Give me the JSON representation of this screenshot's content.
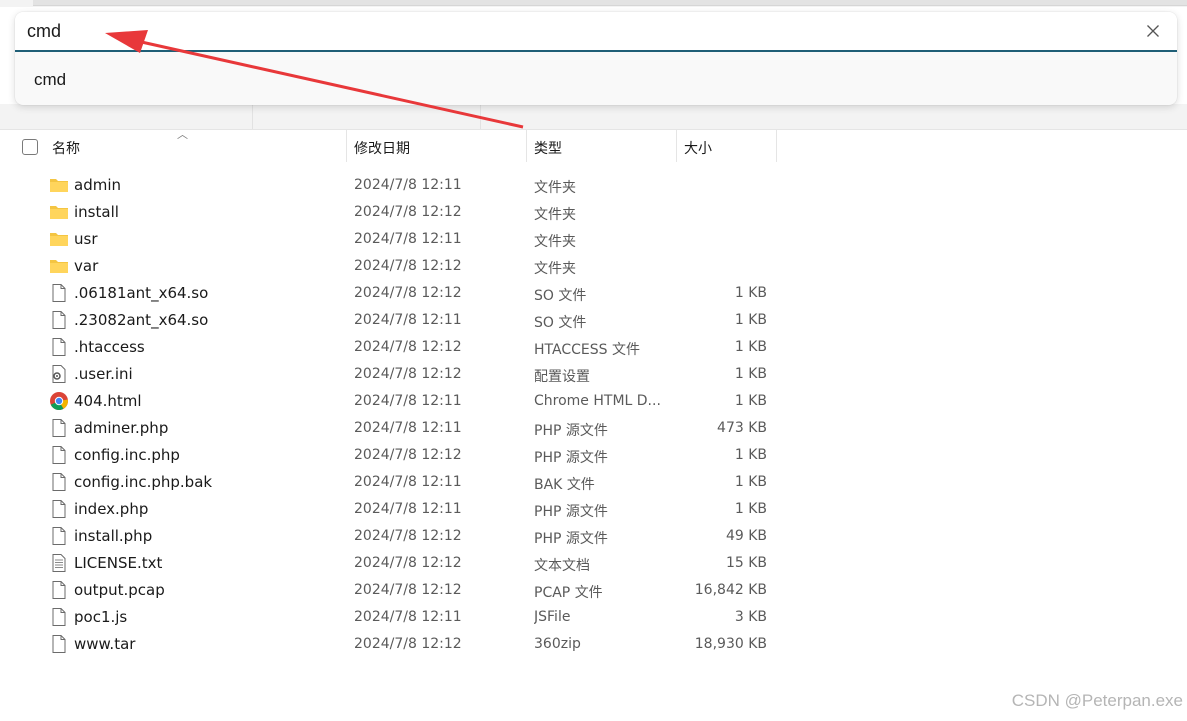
{
  "search": {
    "value": "cmd"
  },
  "suggestions": [
    "cmd"
  ],
  "columns": {
    "name": "名称",
    "modified": "修改日期",
    "type": "类型",
    "size": "大小"
  },
  "files": [
    {
      "name": "admin",
      "modified": "2024/7/8 12:11",
      "type": "文件夹",
      "size": "",
      "icon": "folder-icon"
    },
    {
      "name": "install",
      "modified": "2024/7/8 12:12",
      "type": "文件夹",
      "size": "",
      "icon": "folder-icon"
    },
    {
      "name": "usr",
      "modified": "2024/7/8 12:11",
      "type": "文件夹",
      "size": "",
      "icon": "folder-icon"
    },
    {
      "name": "var",
      "modified": "2024/7/8 12:12",
      "type": "文件夹",
      "size": "",
      "icon": "folder-icon"
    },
    {
      "name": ".06181ant_x64.so",
      "modified": "2024/7/8 12:12",
      "type": "SO 文件",
      "size": "1 KB",
      "icon": "file-icon"
    },
    {
      "name": ".23082ant_x64.so",
      "modified": "2024/7/8 12:11",
      "type": "SO 文件",
      "size": "1 KB",
      "icon": "file-icon"
    },
    {
      "name": ".htaccess",
      "modified": "2024/7/8 12:12",
      "type": "HTACCESS 文件",
      "size": "1 KB",
      "icon": "file-icon"
    },
    {
      "name": ".user.ini",
      "modified": "2024/7/8 12:12",
      "type": "配置设置",
      "size": "1 KB",
      "icon": "settings-file-icon"
    },
    {
      "name": "404.html",
      "modified": "2024/7/8 12:11",
      "type": "Chrome HTML D...",
      "size": "1 KB",
      "icon": "chrome-icon"
    },
    {
      "name": "adminer.php",
      "modified": "2024/7/8 12:11",
      "type": "PHP 源文件",
      "size": "473 KB",
      "icon": "file-icon"
    },
    {
      "name": "config.inc.php",
      "modified": "2024/7/8 12:12",
      "type": "PHP 源文件",
      "size": "1 KB",
      "icon": "file-icon"
    },
    {
      "name": "config.inc.php.bak",
      "modified": "2024/7/8 12:11",
      "type": "BAK 文件",
      "size": "1 KB",
      "icon": "file-icon"
    },
    {
      "name": "index.php",
      "modified": "2024/7/8 12:11",
      "type": "PHP 源文件",
      "size": "1 KB",
      "icon": "file-icon"
    },
    {
      "name": "install.php",
      "modified": "2024/7/8 12:12",
      "type": "PHP 源文件",
      "size": "49 KB",
      "icon": "file-icon"
    },
    {
      "name": "LICENSE.txt",
      "modified": "2024/7/8 12:12",
      "type": "文本文档",
      "size": "15 KB",
      "icon": "text-file-icon"
    },
    {
      "name": "output.pcap",
      "modified": "2024/7/8 12:12",
      "type": "PCAP 文件",
      "size": "16,842 KB",
      "icon": "file-icon"
    },
    {
      "name": "poc1.js",
      "modified": "2024/7/8 12:11",
      "type": "JSFile",
      "size": "3 KB",
      "icon": "file-icon"
    },
    {
      "name": "www.tar",
      "modified": "2024/7/8 12:12",
      "type": "360zip",
      "size": "18,930 KB",
      "icon": "file-icon"
    }
  ],
  "watermark": "CSDN @Peterpan.exe",
  "colors": {
    "accent": "#1f5f77",
    "annotation_arrow": "#e8383a",
    "folder": "#f4c542"
  }
}
